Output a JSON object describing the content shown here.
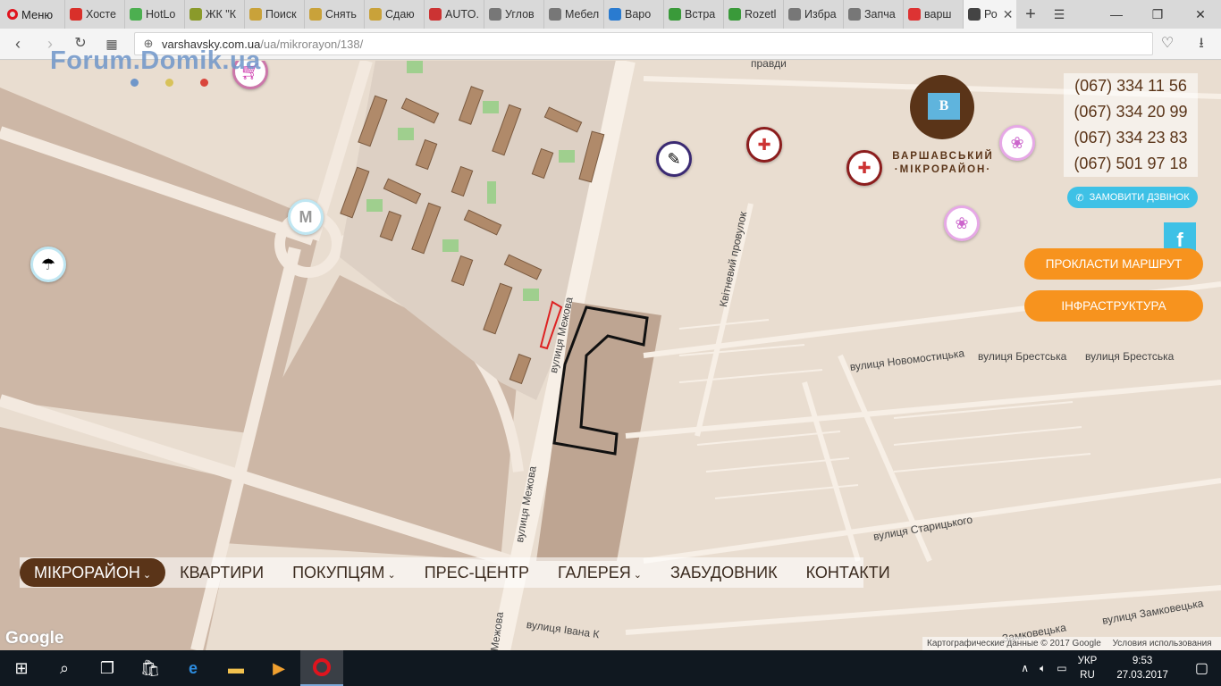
{
  "browser": {
    "menu_label": "Меню",
    "tabs": [
      {
        "label": "Хосте",
        "color": "#d9302a"
      },
      {
        "label": "HotLo",
        "color": "#4caf50"
      },
      {
        "label": "ЖК \"К",
        "color": "#8a9a2a"
      },
      {
        "label": "Поиск",
        "color": "#c9a23a"
      },
      {
        "label": "Снять",
        "color": "#c9a23a"
      },
      {
        "label": "Сдаю",
        "color": "#c9a23a"
      },
      {
        "label": "AUTO.",
        "color": "#c33"
      },
      {
        "label": "Углов",
        "color": "#777"
      },
      {
        "label": "Мебел",
        "color": "#777"
      },
      {
        "label": "Варо",
        "color": "#2a7bd0"
      },
      {
        "label": "Встра",
        "color": "#3a9a3a"
      },
      {
        "label": "Rozetl",
        "color": "#3a9a3a"
      },
      {
        "label": "Избра",
        "color": "#777"
      },
      {
        "label": "Запча",
        "color": "#777"
      },
      {
        "label": "варш",
        "color": "#d33"
      }
    ],
    "active_tab": {
      "label": "Ро",
      "close": "✕"
    },
    "new_tab": "+",
    "url_host": "varshavsky.com.ua",
    "url_path": "/ua/mikrorayon/138/"
  },
  "site": {
    "logo_line1": "ВАРШАВСЬКИЙ",
    "logo_line2": "·МІКРОРАЙОН·",
    "logo_letter": "B",
    "phones": [
      "(067) 334 11 56",
      "(067) 334 20 99",
      "(067) 334 23 83",
      "(067) 501 97 18"
    ],
    "callback": "ЗАМОВИТИ ДЗВІНОК",
    "facebook": "f",
    "route_button": "ПРОКЛАСТИ МАРШРУТ",
    "infra_button": "ІНФРАСТРУКТУРА",
    "menu": [
      {
        "label": "МІКРОРАЙОН",
        "has_dropdown": true,
        "active": true
      },
      {
        "label": "КВАРТИРИ",
        "has_dropdown": false
      },
      {
        "label": "ПОКУПЦЯМ",
        "has_dropdown": true
      },
      {
        "label": "ПРЕС-ЦЕНТР",
        "has_dropdown": false
      },
      {
        "label": "ГАЛЕРЕЯ",
        "has_dropdown": true
      },
      {
        "label": "ЗАБУДОВНИК",
        "has_dropdown": false
      },
      {
        "label": "КОНТАКТИ",
        "has_dropdown": false
      }
    ],
    "colors": {
      "brand": "#5a3418",
      "accent": "#f7931e",
      "callback": "#3ec1e6"
    }
  },
  "map": {
    "streets": [
      "вулиця Межова",
      "вулиця Межова",
      "Межова",
      "Квітневий провулок",
      "вулиця Новомостицька",
      "вулиця Брестська",
      "вулиця Брестська",
      "вулиця Старицького",
      "Замковецька",
      "вулиця Замковецька",
      "вулиця Івана К",
      "правди"
    ],
    "google": "Google",
    "credit": "Картографические данные © 2017 Google",
    "terms": "Условия использования",
    "metro": "M"
  },
  "watermark": "Forum.Domik.ua",
  "taskbar": {
    "lang_line1": "УКР",
    "lang_line2": "RU",
    "time": "9:53",
    "date": "27.03.2017"
  }
}
